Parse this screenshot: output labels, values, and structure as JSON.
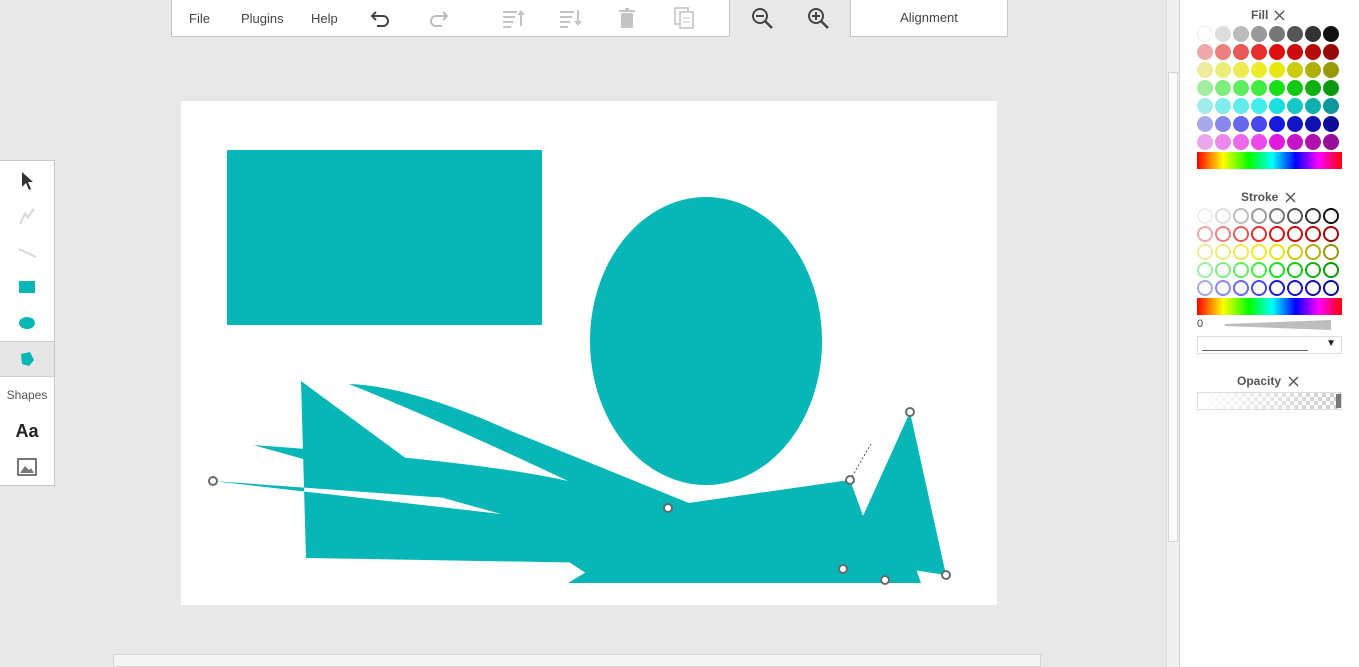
{
  "menu": {
    "file": "File",
    "plugins": "Plugins",
    "help": "Help"
  },
  "toolbar_icons": [
    "undo-icon",
    "redo-icon",
    "move-back-icon",
    "move-forward-icon",
    "trash-icon",
    "copy-icon"
  ],
  "zoom": [
    "zoom-out-icon",
    "zoom-in-icon"
  ],
  "alignment_label": "Alignment",
  "tools": {
    "shapes_label": "Shapes",
    "text_label": "Aa",
    "items": [
      "select-pointer-icon",
      "pen-icon",
      "line-icon",
      "rectangle-icon",
      "ellipse-icon",
      "polygon-icon",
      "text-icon",
      "image-icon"
    ]
  },
  "canvas": {
    "shape_color": "#07b6b6",
    "background": "#ffffff"
  },
  "panel": {
    "fill_title": "Fill",
    "stroke_title": "Stroke",
    "opacity_title": "Opacity",
    "stroke_width": "0",
    "fill_rows": [
      [
        "#ffffff",
        "#dddddd",
        "#bbbbbb",
        "#999999",
        "#777777",
        "#555555",
        "#333333",
        "#111111"
      ],
      [
        "#f0a8a8",
        "#ec8080",
        "#e85858",
        "#e63030",
        "#e01010",
        "#cc0c0c",
        "#b40a0a",
        "#980808"
      ],
      [
        "#ecec9c",
        "#ecec78",
        "#ecec50",
        "#ecec28",
        "#e8e810",
        "#cccc0c",
        "#b0b00a",
        "#989808"
      ],
      [
        "#a0eca0",
        "#80ec80",
        "#60ec60",
        "#40ec40",
        "#18e018",
        "#14c814",
        "#10b010",
        "#0c980c"
      ],
      [
        "#a0ecec",
        "#80ecec",
        "#60ecec",
        "#40ecec",
        "#18e0e0",
        "#14c8c8",
        "#10b0b0",
        "#0c9898"
      ],
      [
        "#a8a8ec",
        "#8888ec",
        "#6868ec",
        "#4848ec",
        "#1818e0",
        "#1414c8",
        "#1010b0",
        "#0c0c98"
      ],
      [
        "#eca8ec",
        "#ec88ec",
        "#ec68ec",
        "#ec48ec",
        "#e018e0",
        "#c814c8",
        "#b010b0",
        "#980c98"
      ]
    ],
    "stroke_rows": [
      [
        "#eeeeee",
        "#dddddd",
        "#bbbbbb",
        "#999999",
        "#777777",
        "#555555",
        "#333333",
        "#111111"
      ],
      [
        "#f0a8a8",
        "#ec8080",
        "#e85858",
        "#e63030",
        "#e01010",
        "#cc0c0c",
        "#b40a0a",
        "#980808"
      ],
      [
        "#ecec9c",
        "#ecec78",
        "#ecec50",
        "#ecec28",
        "#e8e810",
        "#cccc0c",
        "#b0b00a",
        "#989808"
      ],
      [
        "#a0eca0",
        "#80ec80",
        "#60ec60",
        "#40ec40",
        "#18e018",
        "#14c814",
        "#10b010",
        "#0c980c"
      ],
      [
        "#a8a8ec",
        "#8888ec",
        "#6868ec",
        "#4848ec",
        "#1818e0",
        "#1414c8",
        "#1010b0",
        "#0c0c98"
      ]
    ]
  }
}
